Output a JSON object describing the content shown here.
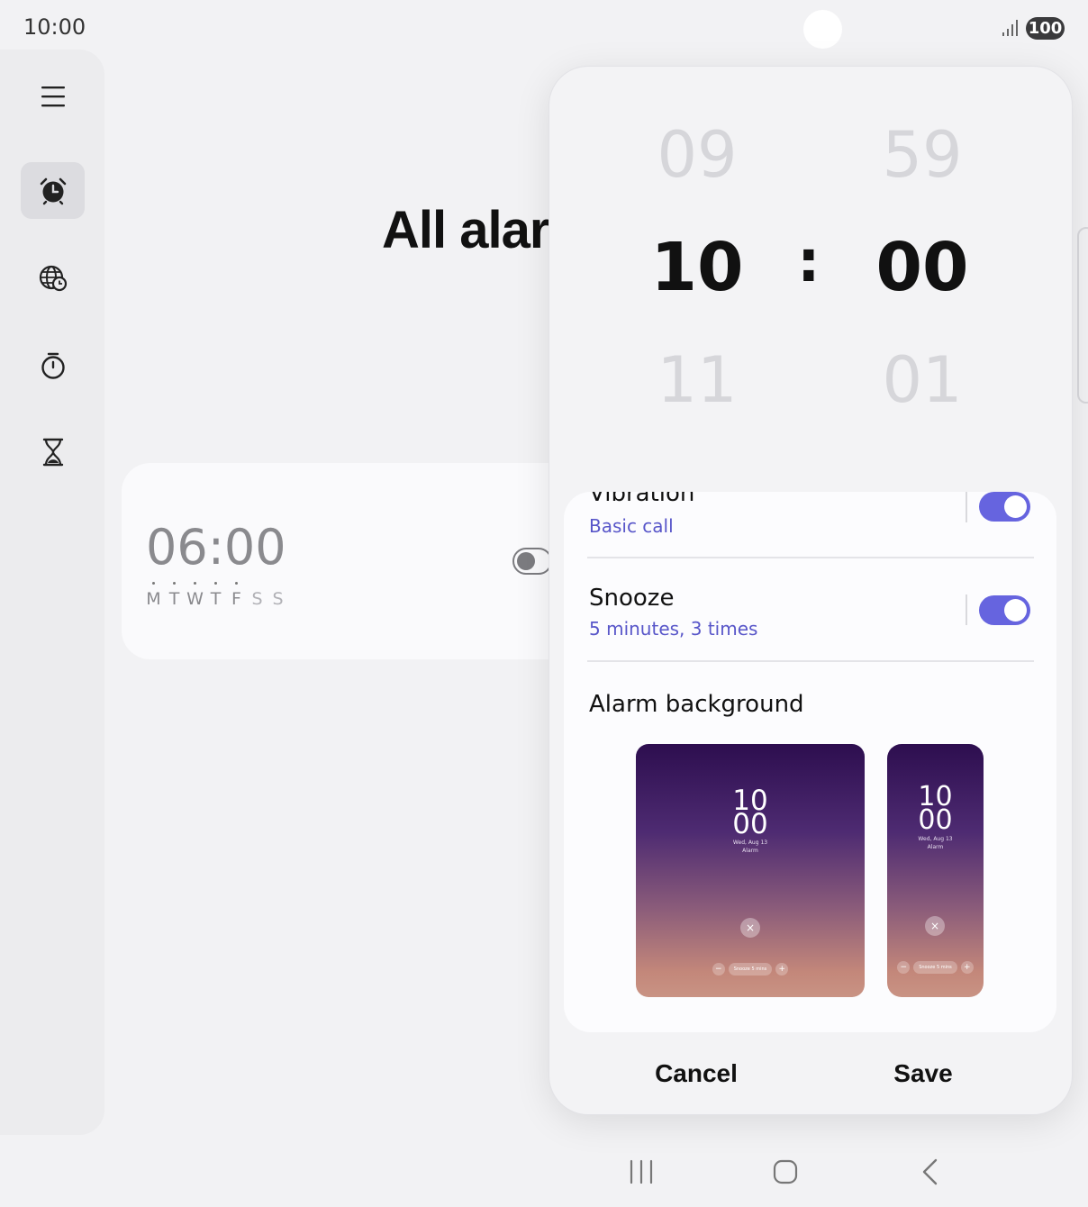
{
  "status_bar": {
    "time": "10:00",
    "battery": "100",
    "signal_icon": "signal-icon"
  },
  "rail": {
    "items": [
      {
        "name": "menu",
        "icon": "hamburger-icon"
      },
      {
        "name": "alarm",
        "icon": "alarm-clock-icon",
        "active": true
      },
      {
        "name": "world-clock",
        "icon": "globe-clock-icon"
      },
      {
        "name": "stopwatch",
        "icon": "stopwatch-icon"
      },
      {
        "name": "timer",
        "icon": "hourglass-icon"
      }
    ]
  },
  "main": {
    "title": "All alar",
    "alarm": {
      "time": "06:00",
      "days": [
        "M",
        "T",
        "W",
        "T",
        "F",
        "S",
        "S"
      ],
      "enabled": false
    }
  },
  "dialog": {
    "picker": {
      "hour_prev": "09",
      "hour": "10",
      "hour_next": "11",
      "separator": ":",
      "minute_prev": "59",
      "minute": "00",
      "minute_next": "01"
    },
    "settings": {
      "vibration": {
        "title": "Vibration",
        "value": "Basic call",
        "on": true
      },
      "snooze": {
        "title": "Snooze",
        "value": "5 minutes, 3 times",
        "on": true
      },
      "background": {
        "title": "Alarm background"
      }
    },
    "preview": {
      "hour": "10",
      "minute": "00",
      "date": "Wed, Aug 13",
      "label": "Alarm",
      "dismiss": "×",
      "snooze_minus": "−",
      "snooze_plus": "+",
      "snooze_label": "Snooze 5 mins"
    },
    "cancel_label": "Cancel",
    "save_label": "Save"
  },
  "colors": {
    "accent": "#6664df",
    "subtext": "#5856c9",
    "background": "#f2f2f4"
  }
}
